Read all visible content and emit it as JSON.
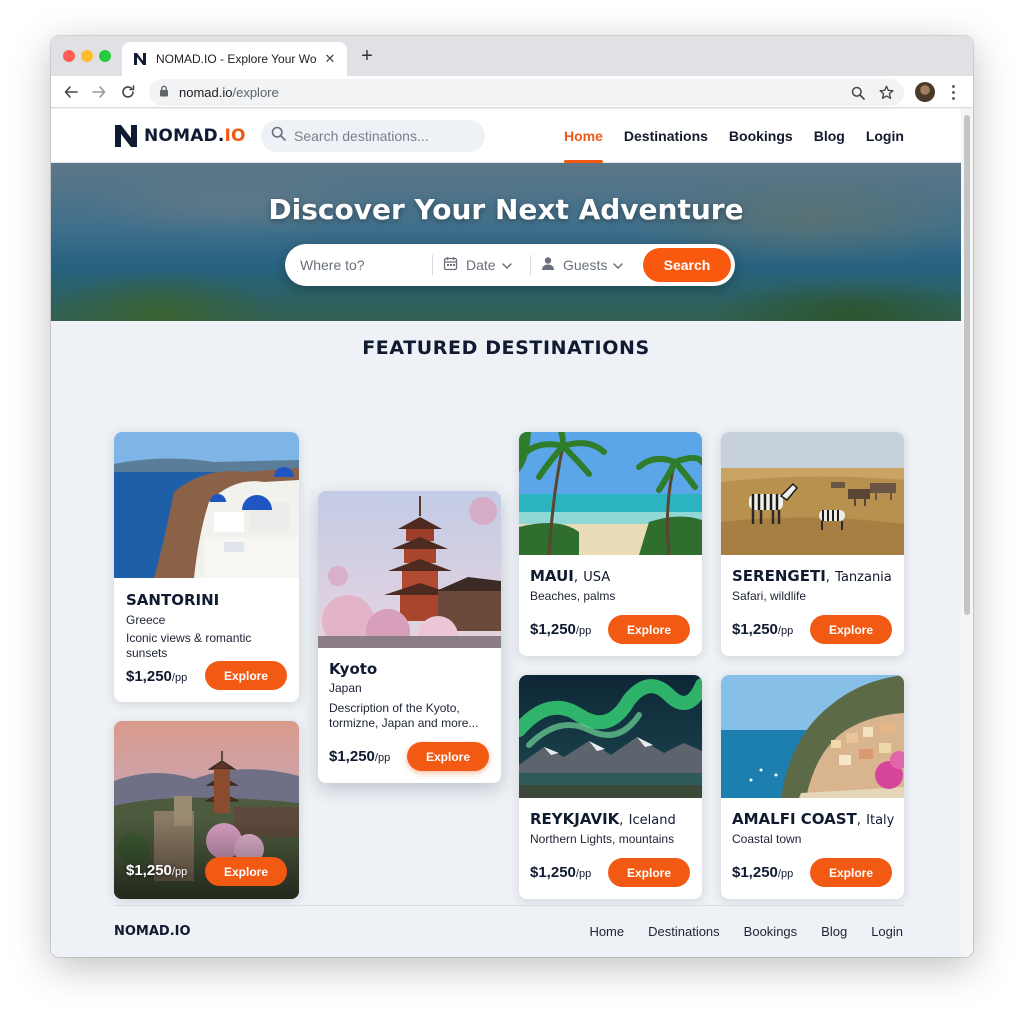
{
  "browser": {
    "tab_title": "NOMAD.IO - Explore Your World",
    "url_host": "nomad.io",
    "url_path": "/explore"
  },
  "site": {
    "brand_main": "NOMAD.",
    "brand_accent": "IO",
    "search_placeholder": "Search destinations...",
    "nav": [
      "Home",
      "Destinations",
      "Bookings",
      "Blog",
      "Login"
    ],
    "active_nav": "Home",
    "accent_color": "#f25a14"
  },
  "hero": {
    "title": "Discover Your Next Adventure",
    "where_placeholder": "Where to?",
    "date_label": "Date",
    "guests_label": "Guests",
    "search_button": "Search"
  },
  "featured": {
    "title": "FEATURED DESTINATIONS",
    "cards": [
      {
        "name": "SANTORINI",
        "country": "Greece",
        "desc": "Iconic views & romantic sunsets",
        "price": "$1,250",
        "unit": "/pp",
        "button": "Explore"
      },
      {
        "name": "",
        "country": "",
        "desc": "",
        "price": "$1,250",
        "unit": "/pp",
        "button": "Explore"
      },
      {
        "name": "Kyoto",
        "country": "Japan",
        "desc": "Description of the Kyoto, tormizne, Japan and more...",
        "price": "$1,250",
        "unit": "/pp",
        "button": "Explore"
      },
      {
        "name": "MAUI",
        "country": "USA",
        "desc": "Beaches, palms",
        "price": "$1,250",
        "unit": "/pp",
        "button": "Explore"
      },
      {
        "name": "SERENGETI",
        "country": "Tanzania",
        "desc": "Safari, wildlife",
        "price": "$1,250",
        "unit": "/pp",
        "button": "Explore"
      },
      {
        "name": "REYKJAVIK",
        "country": "Iceland",
        "desc": "Northern Lights, mountains",
        "price": "$1,250",
        "unit": "/pp",
        "button": "Explore"
      },
      {
        "name": "AMALFI COAST",
        "country": "Italy",
        "desc": "Coastal town",
        "price": "$1,250",
        "unit": "/pp",
        "button": "Explore"
      }
    ]
  },
  "footer": {
    "brand": "NOMAD.IO",
    "links": [
      "Home",
      "Destinations",
      "Bookings",
      "Blog",
      "Login"
    ]
  },
  "separators": {
    "comma": ","
  },
  "icons": [
    "logo-n-icon",
    "search-icon",
    "calendar-icon",
    "user-icon",
    "chevron-down-icon",
    "back-icon",
    "forward-icon",
    "reload-icon",
    "lock-icon",
    "zoom-icon",
    "star-icon",
    "close-icon",
    "plus-icon"
  ]
}
